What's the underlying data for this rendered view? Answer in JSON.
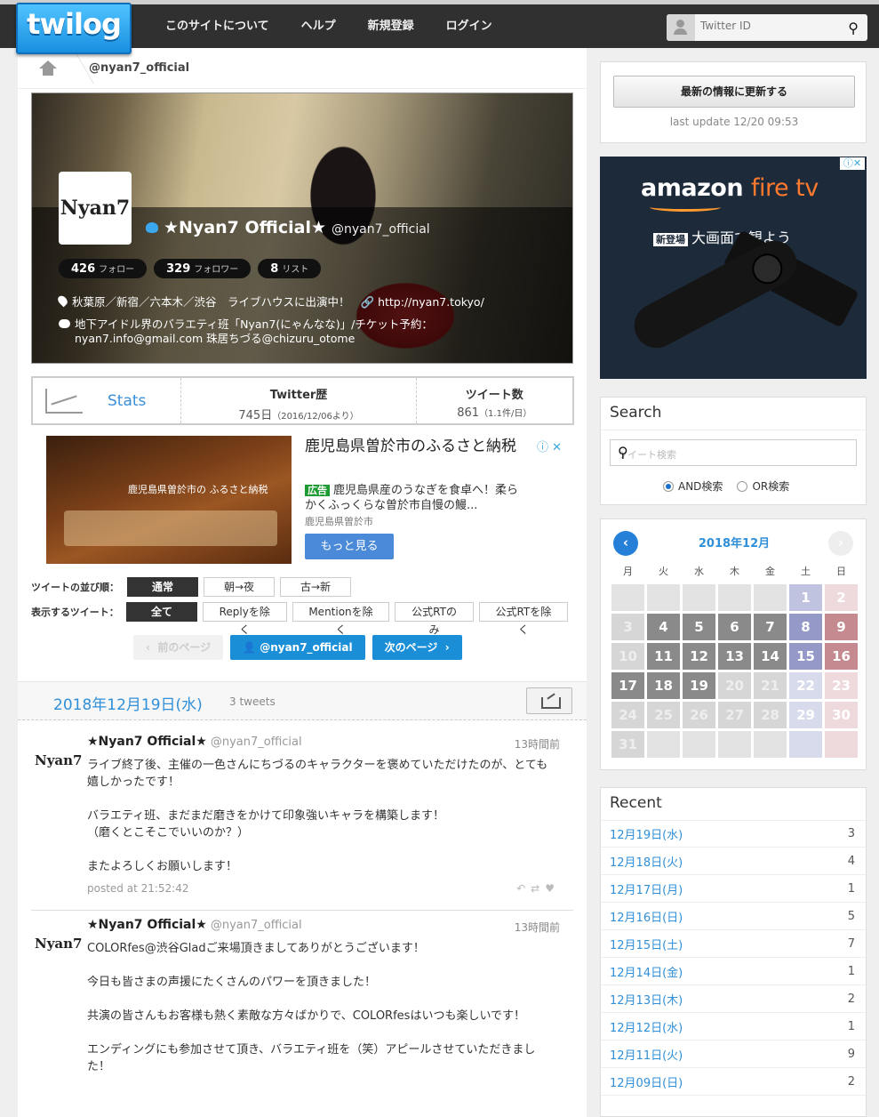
{
  "header": {
    "logo": "twilog",
    "nav": [
      "このサイトについて",
      "ヘルプ",
      "新規登録",
      "ログイン"
    ],
    "search_placeholder": "Twitter ID"
  },
  "breadcrumb": {
    "user": "@nyan7_official"
  },
  "profile": {
    "avatar_text": "Nyan7",
    "name": "★Nyan7 Official★",
    "handle": "@nyan7_official",
    "follow_count": "426",
    "follow_label": "フォロー",
    "follower_count": "329",
    "follower_label": "フォロワー",
    "list_count": "8",
    "list_label": "リスト",
    "location": "秋葉原／新宿／六本木／渋谷　ライブハウスに出演中！",
    "url": "http://nyan7.tokyo/",
    "description": "地下アイドル界のバラエティ班「Nyan7(にゃんなな)」/チケット予約：nyan7.info@gmail.com 珠居ちづる@chizuru_otome"
  },
  "stats": {
    "label": "Stats",
    "history_label": "Twitter歴",
    "history_value": "745日",
    "history_sub": "（2016/12/06より）",
    "tweets_label": "ツイート数",
    "tweets_value": "861",
    "tweets_sub": "（1.1件/日）"
  },
  "ad": {
    "image_text": "鹿児島県曽於市の ふるさと納税",
    "title": "鹿児島県曽於市のふるさと納税",
    "badge": "広告",
    "text": "鹿児島県産のうなぎを食卓へ！柔らかくふっくらな曽於市自慢の鰻...",
    "source": "鹿児島県曽於市",
    "more": "もっと見る"
  },
  "filters": {
    "order_label": "ツイートの並び順：",
    "order": [
      "通常",
      "朝→夜",
      "古→新"
    ],
    "show_label": "表示するツイート：",
    "show": [
      "全て",
      "Replyを除く",
      "Mentionを除く",
      "公式RTのみ",
      "公式RTを除く"
    ]
  },
  "pager": {
    "prev": "前のページ",
    "user": "@nyan7_official",
    "next": "次のページ"
  },
  "day": {
    "date": "2018年12月19日(水)",
    "count": "3 tweets"
  },
  "tweets": [
    {
      "name": "★Nyan7 Official★",
      "handle": "@nyan7_official",
      "time": "13時間前",
      "body": "ライブ終了後、主催の一色さんにちづるのキャラクターを褒めていただけたのが、とても嬉しかったです！\n\nバラエティ班、まだまだ磨きをかけて印象強いキャラを構築します！\n（磨くとこそこでいいのか？）\n\nまたよろしくお願いします！",
      "posted": "posted at 21:52:42"
    },
    {
      "name": "★Nyan7 Official★",
      "handle": "@nyan7_official",
      "time": "13時間前",
      "body": "COLORfes@渋谷Gladご来場頂きましてありがとうございます！\n\n今日も皆さまの声援にたくさんのパワーを頂きました！\n\n共演の皆さんもお客様も熱く素敵な方々ばかりで、COLORfesはいつも楽しいです！\n\nエンディングにも参加させて頂き、バラエティ班を（笑）アピールさせていただきました！"
    }
  ],
  "update": {
    "button": "最新の情報に更新する",
    "last": "last update 12/20 09:53"
  },
  "amazon_ad": {
    "brand": "amazon",
    "product": "fire tv",
    "badge": "新登場",
    "tagline": "大画面で観よう"
  },
  "search": {
    "title": "Search",
    "placeholder": "ツイート検索",
    "and": "AND検索",
    "or": "OR検索"
  },
  "calendar": {
    "month": "2018年12月",
    "weekdays": [
      "月",
      "火",
      "水",
      "木",
      "金",
      "土",
      "日"
    ],
    "days": [
      {
        "d": "",
        "s": "e"
      },
      {
        "d": "",
        "s": "e"
      },
      {
        "d": "",
        "s": "e"
      },
      {
        "d": "",
        "s": "e"
      },
      {
        "d": "",
        "s": "e"
      },
      {
        "d": "1",
        "s": "fsp"
      },
      {
        "d": "2",
        "s": "ful"
      },
      {
        "d": "3",
        "s": "f"
      },
      {
        "d": "4",
        "s": "a"
      },
      {
        "d": "5",
        "s": "a"
      },
      {
        "d": "6",
        "s": "a"
      },
      {
        "d": "7",
        "s": "a"
      },
      {
        "d": "8",
        "s": "fs"
      },
      {
        "d": "9",
        "s": "fu"
      },
      {
        "d": "10",
        "s": "f"
      },
      {
        "d": "11",
        "s": "a"
      },
      {
        "d": "12",
        "s": "a"
      },
      {
        "d": "13",
        "s": "a"
      },
      {
        "d": "14",
        "s": "a"
      },
      {
        "d": "15",
        "s": "fs"
      },
      {
        "d": "16",
        "s": "fu"
      },
      {
        "d": "17",
        "s": "a"
      },
      {
        "d": "18",
        "s": "a"
      },
      {
        "d": "19",
        "s": "a"
      },
      {
        "d": "20",
        "s": "f"
      },
      {
        "d": "21",
        "s": "f"
      },
      {
        "d": "22",
        "s": "fsl"
      },
      {
        "d": "23",
        "s": "ful"
      },
      {
        "d": "24",
        "s": "f"
      },
      {
        "d": "25",
        "s": "f"
      },
      {
        "d": "26",
        "s": "f"
      },
      {
        "d": "27",
        "s": "f"
      },
      {
        "d": "28",
        "s": "f"
      },
      {
        "d": "29",
        "s": "fsl"
      },
      {
        "d": "30",
        "s": "ful"
      },
      {
        "d": "31",
        "s": "f"
      },
      {
        "d": "",
        "s": "e"
      },
      {
        "d": "",
        "s": "e"
      },
      {
        "d": "",
        "s": "e"
      },
      {
        "d": "",
        "s": "e"
      },
      {
        "d": "",
        "s": "fsl"
      },
      {
        "d": "",
        "s": "ful"
      }
    ]
  },
  "recent": {
    "title": "Recent",
    "items": [
      {
        "date": "12月19日(水)",
        "count": "3"
      },
      {
        "date": "12月18日(火)",
        "count": "4"
      },
      {
        "date": "12月17日(月)",
        "count": "1"
      },
      {
        "date": "12月16日(日)",
        "count": "5"
      },
      {
        "date": "12月15日(土)",
        "count": "7"
      },
      {
        "date": "12月14日(金)",
        "count": "1"
      },
      {
        "date": "12月13日(木)",
        "count": "2"
      },
      {
        "date": "12月12日(水)",
        "count": "1"
      },
      {
        "date": "12月11日(火)",
        "count": "9"
      },
      {
        "date": "12月09日(日)",
        "count": "2"
      }
    ]
  }
}
